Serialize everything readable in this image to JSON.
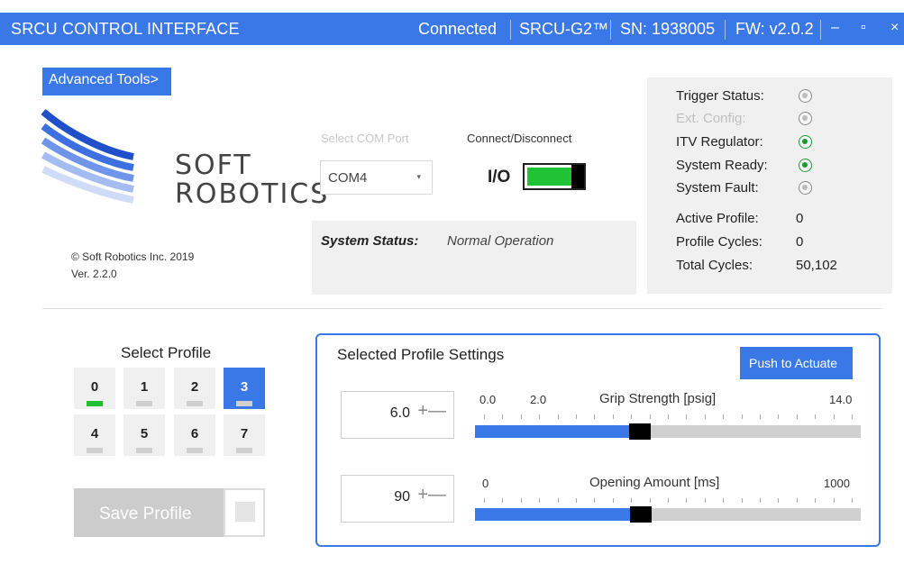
{
  "titlebar": {
    "app_title": "SRCU CONTROL INTERFACE",
    "connection": "Connected",
    "device": "SRCU-G2™",
    "serial": "SN: 1938005",
    "firmware": "FW: v2.0.2",
    "minimize": "–",
    "maximize": "▫",
    "close": "×"
  },
  "advanced_tools_label": "Advanced Tools>",
  "logo": {
    "line1": "SOFT",
    "line2": "ROBOTICS"
  },
  "copyright": "© Soft Robotics Inc. 2019",
  "version": "Ver. 2.2.0",
  "com_port": {
    "label": "Select COM Port",
    "value": "COM4",
    "caret": "▾"
  },
  "connect": {
    "label": "Connect/Disconnect",
    "io_label": "I/O",
    "state": "on"
  },
  "system_status": {
    "label": "System Status:",
    "value": "Normal Operation"
  },
  "status_panel": {
    "indicators": [
      {
        "label": "Trigger Status:",
        "state": "off",
        "enabled": true
      },
      {
        "label": "Ext. Config:",
        "state": "off",
        "enabled": false
      },
      {
        "label": "ITV Regulator:",
        "state": "on",
        "enabled": true
      },
      {
        "label": "System Ready:",
        "state": "on",
        "enabled": true
      },
      {
        "label": "System Fault:",
        "state": "off",
        "enabled": true
      }
    ],
    "values": [
      {
        "label": "Active Profile:",
        "value": "0"
      },
      {
        "label": "Profile Cycles:",
        "value": "0"
      },
      {
        "label": "Total Cycles:",
        "value": "50,102"
      }
    ]
  },
  "profiles": {
    "title": "Select Profile",
    "items": [
      "0",
      "1",
      "2",
      "3",
      "4",
      "5",
      "6",
      "7"
    ],
    "selected": "3",
    "active_indicator": "0"
  },
  "save_profile_label": "Save Profile",
  "settings": {
    "title": "Selected Profile Settings",
    "push_label": "Push to Actuate",
    "grip": {
      "value": "6.0",
      "plus": "+",
      "minus": "—",
      "title": "Grip Strength [psig]",
      "tick_labels": [
        "0.0",
        "2.0",
        "14.0"
      ],
      "min": 0.0,
      "max": 14.0,
      "level": 6.0
    },
    "opening": {
      "value": "90",
      "plus": "+",
      "minus": "—",
      "title": "Opening Amount [ms]",
      "tick_labels": [
        "0",
        "1000"
      ],
      "min": 0,
      "max": 1000,
      "fill_fraction": 0.43
    }
  },
  "colors": {
    "accent": "#3b78e7",
    "green": "#22c235",
    "panel": "#f0f0f0"
  }
}
